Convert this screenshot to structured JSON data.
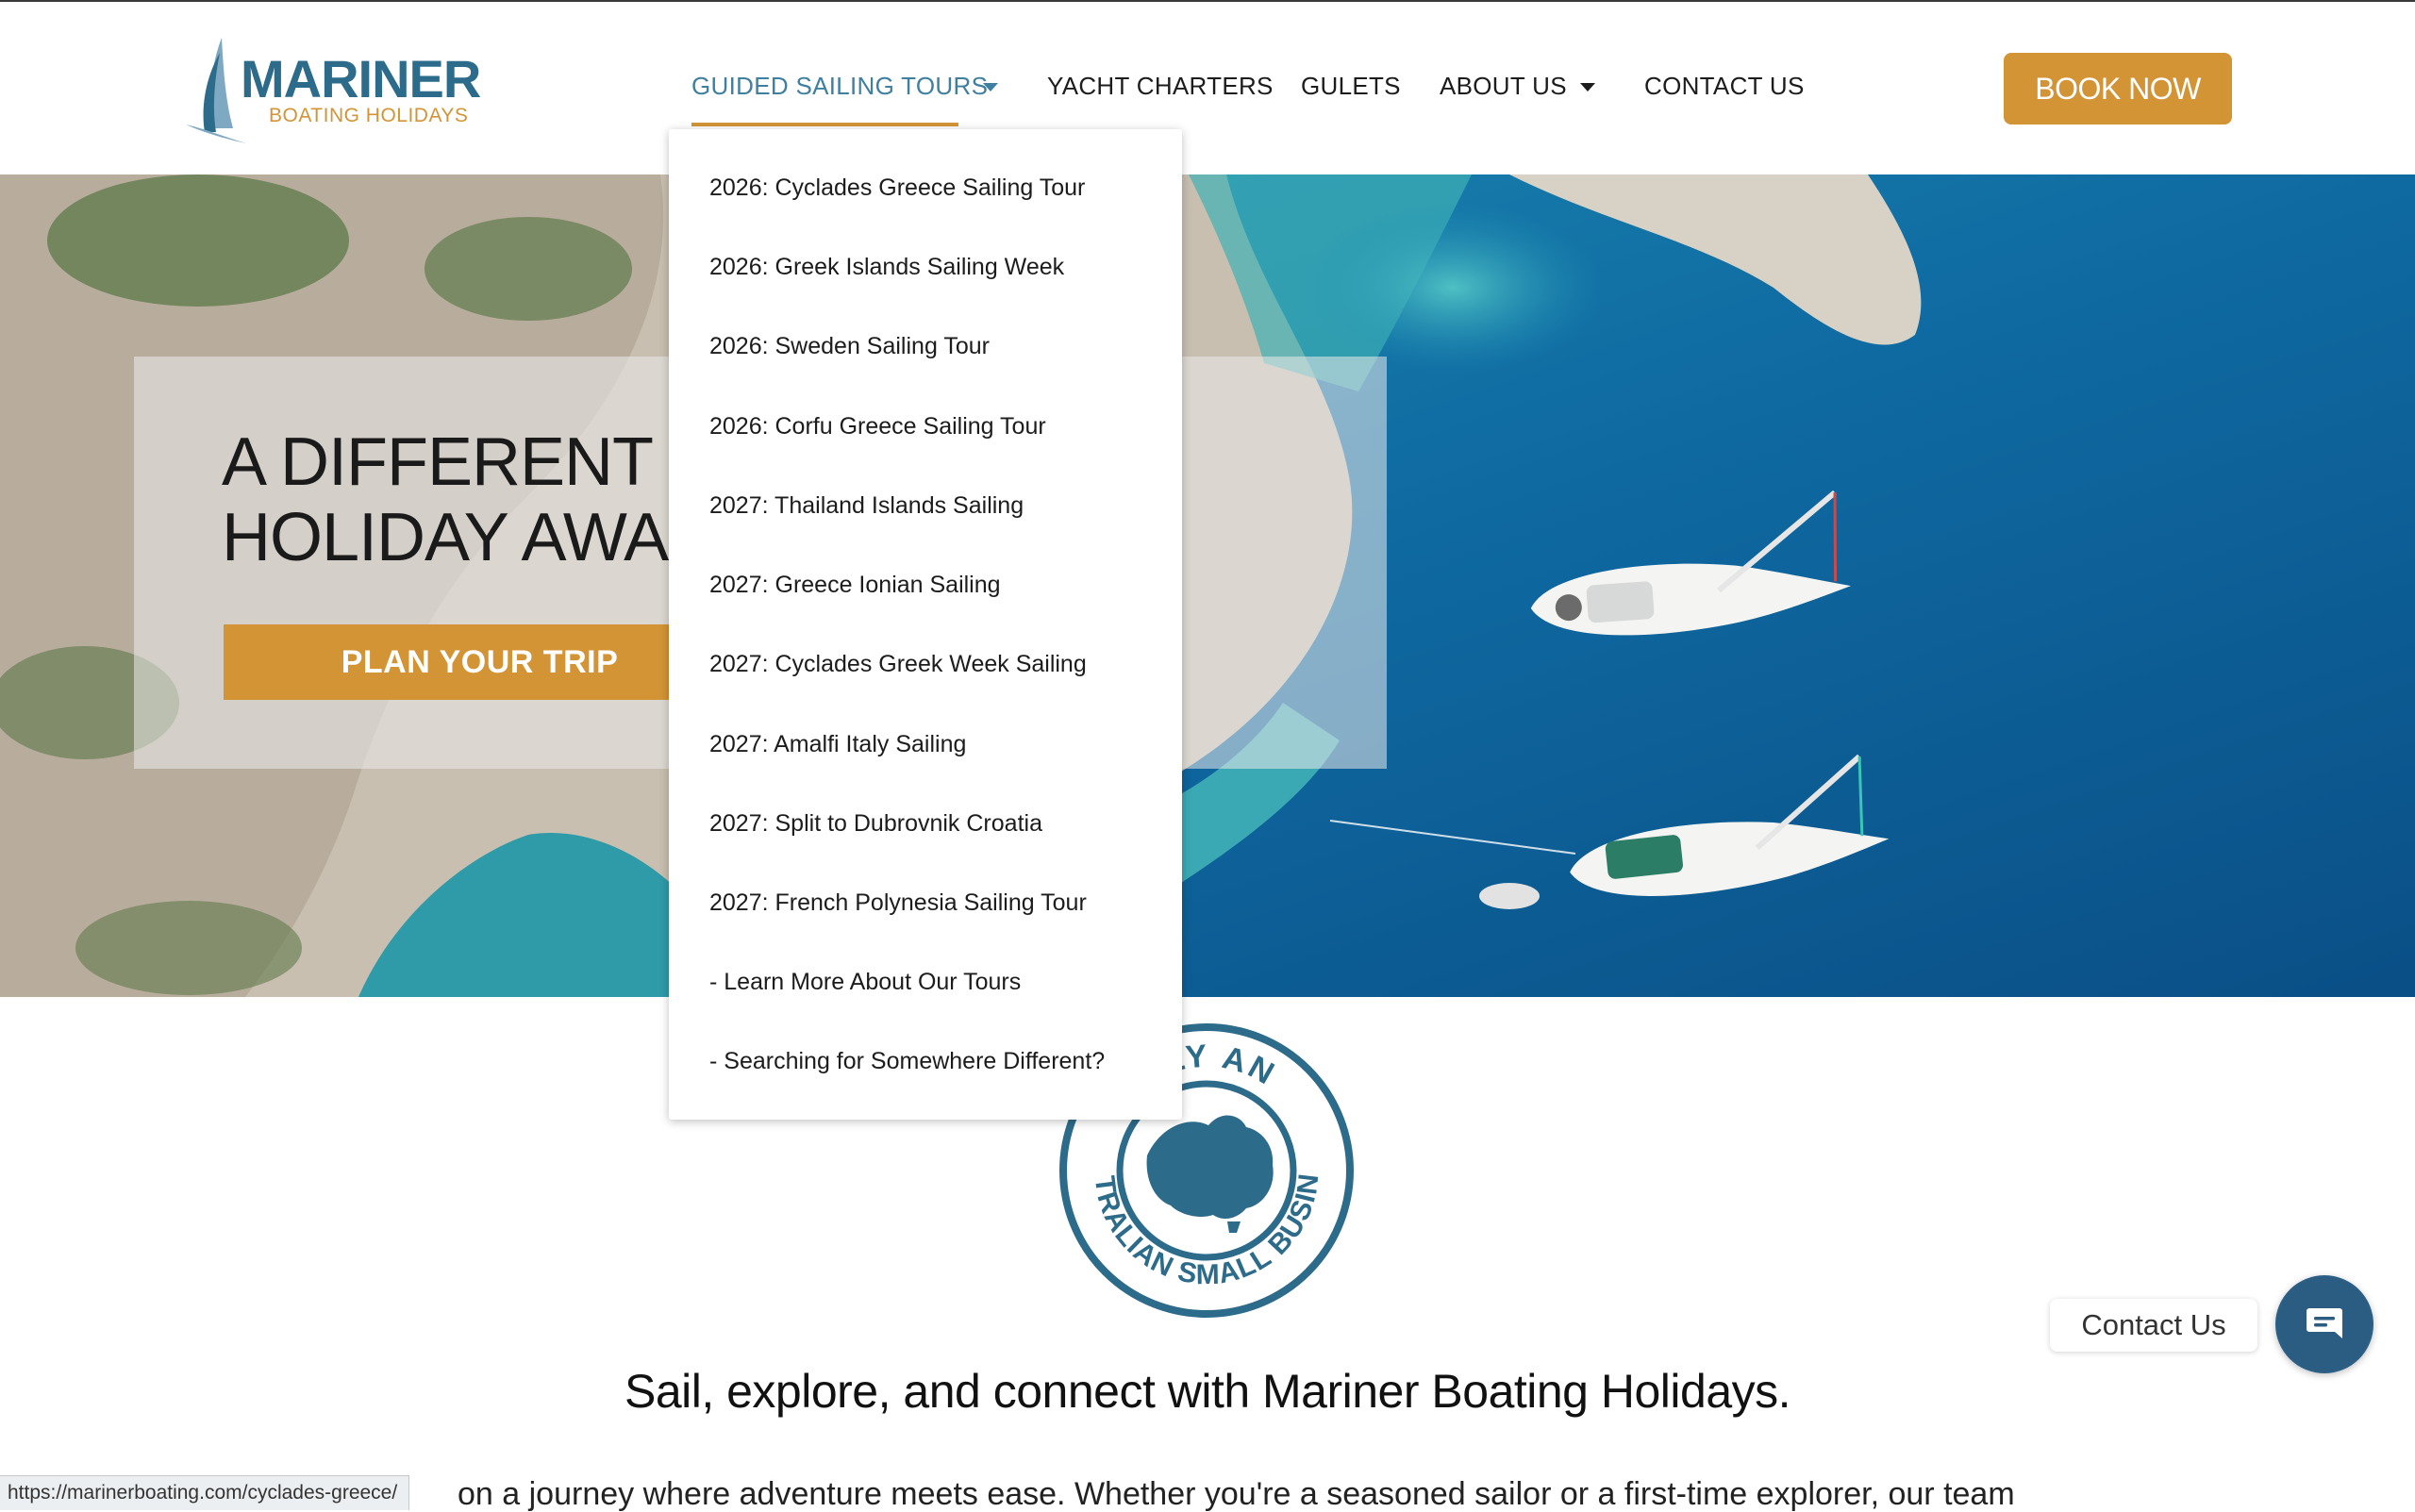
{
  "brand": {
    "name": "MARINER",
    "subtitle": "BOATING HOLIDAYS",
    "colors": {
      "primary": "#2d6b8a",
      "accent": "#d39436"
    }
  },
  "nav": {
    "items": [
      {
        "label": "GUIDED SAILING TOURS",
        "has_dropdown": true,
        "active": true
      },
      {
        "label": "YACHT CHARTERS",
        "has_dropdown": false
      },
      {
        "label": "GULETS",
        "has_dropdown": false
      },
      {
        "label": "ABOUT US",
        "has_dropdown": true
      },
      {
        "label": "CONTACT US",
        "has_dropdown": false
      }
    ],
    "book_label": "BOOK NOW"
  },
  "dropdown": {
    "items": [
      "2026: Cyclades Greece Sailing Tour",
      "2026: Greek Islands Sailing Week",
      "2026: Sweden Sailing Tour",
      "2026: Corfu Greece Sailing Tour",
      "2027: Thailand Islands Sailing",
      "2027: Greece Ionian Sailing",
      "2027: Cyclades Greek Week Sailing",
      "2027: Amalfi Italy Sailing",
      "2027: Split to Dubrovnik Croatia",
      "2027: French Polynesia Sailing Tour",
      "- Learn More About Our Tours",
      "- Searching for Somewhere Different?"
    ]
  },
  "hero": {
    "title_line1": "A DIFFERENT K",
    "title_line2": "HOLIDAY AWA",
    "cta_label": "PLAN YOUR TRIP"
  },
  "badge": {
    "text_top": "DLY AN",
    "text_bottom": "AUSTRALIAN SMALL BUSINESS"
  },
  "content": {
    "tagline": "Sail, explore, and connect with Mariner Boating Holidays.",
    "paragraph": "on a journey where adventure meets ease. Whether you're a seasoned sailor or a first-time explorer, our team"
  },
  "contact_widget": {
    "label": "Contact Us",
    "icon": "chat-icon"
  },
  "status_url": "https://marinerboating.com/cyclades-greece/"
}
